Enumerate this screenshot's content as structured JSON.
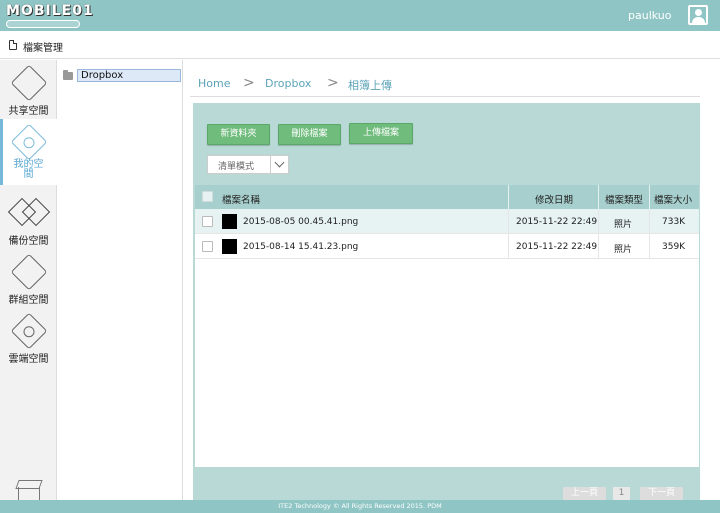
{
  "header": {
    "logo_text": "MOBILE01",
    "username": "paulkuo"
  },
  "subheader": {
    "title": "檔案管理"
  },
  "nav": {
    "items": [
      {
        "label": "共享空間"
      },
      {
        "label": "我的空間"
      },
      {
        "label": "備份空間"
      },
      {
        "label": "群組空間"
      },
      {
        "label": "雲端空間"
      }
    ],
    "active": "我的空間"
  },
  "tree": {
    "items": [
      {
        "label": "Dropbox"
      }
    ]
  },
  "breadcrumb": {
    "items": [
      "Home",
      "Dropbox",
      "相簿上傳"
    ],
    "separator": ">"
  },
  "toolbar": {
    "new_folder": "新資料夾",
    "delete_file": "刪除檔案",
    "upload_file": "上傳檔案",
    "view_mode": "清單模式"
  },
  "table": {
    "columns": [
      "檔案名稱",
      "修改日期",
      "檔案類型",
      "檔案大小"
    ],
    "rows": [
      {
        "name": "2015-08-05 00.45.41.png",
        "modified": "2015-11-22 22:49",
        "type": "照片",
        "size": "733K"
      },
      {
        "name": "2015-08-14 15.41.23.png",
        "modified": "2015-11-22 22:49",
        "type": "照片",
        "size": "359K"
      }
    ]
  },
  "pagination": {
    "prev": "上一頁",
    "current": "1",
    "next": "下一頁"
  },
  "footer": {
    "text": "ITE2 Technology © All Rights Reserved 2015. PDM"
  },
  "colors": {
    "header_bg": "#8fc5c4",
    "panel_bg": "#b9d9d7",
    "button_green": "#6fbc7d",
    "accent_blue": "#5aa7d2"
  }
}
